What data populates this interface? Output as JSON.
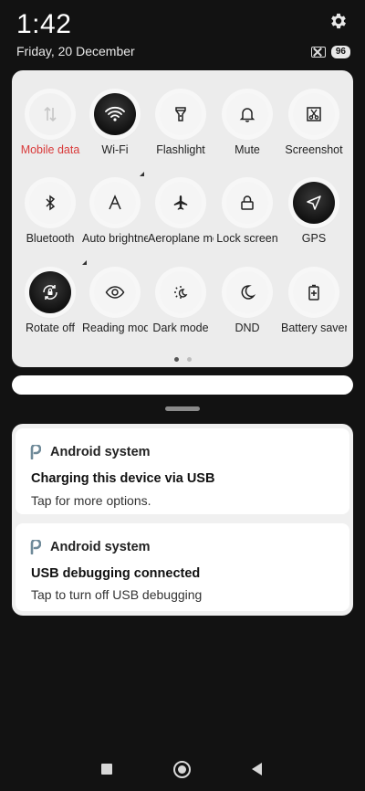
{
  "status_bar": {
    "time": "1:42",
    "date": "Friday, 20 December",
    "battery": "96"
  },
  "tiles": [
    {
      "label": "Mobile data",
      "state": "disabled",
      "icon": "mobile-data-icon",
      "label_color": "#d93a3a"
    },
    {
      "label": "Wi-Fi",
      "state": "on",
      "icon": "wifi-icon",
      "expandable": true
    },
    {
      "label": "Flashlight",
      "state": "off",
      "icon": "flashlight-icon"
    },
    {
      "label": "Mute",
      "state": "off",
      "icon": "bell-icon"
    },
    {
      "label": "Screenshot",
      "state": "off",
      "icon": "screenshot-icon"
    },
    {
      "label": "Bluetooth",
      "state": "off",
      "icon": "bluetooth-icon",
      "expandable": true
    },
    {
      "label": "Auto brightness",
      "state": "off",
      "icon": "auto-brightness-icon"
    },
    {
      "label": "Aeroplane mode",
      "state": "off",
      "icon": "aeroplane-icon"
    },
    {
      "label": "Lock screen",
      "state": "off",
      "icon": "lock-icon"
    },
    {
      "label": "GPS",
      "state": "on",
      "icon": "location-arrow-icon"
    },
    {
      "label": "Rotate off",
      "state": "on",
      "icon": "rotate-lock-icon"
    },
    {
      "label": "Reading mode",
      "state": "off",
      "icon": "eye-icon"
    },
    {
      "label": "Dark mode",
      "state": "off",
      "icon": "dark-mode-icon"
    },
    {
      "label": "DND",
      "state": "off",
      "icon": "moon-icon"
    },
    {
      "label": "Battery saver",
      "state": "off",
      "icon": "battery-saver-icon"
    }
  ],
  "pager": {
    "pages": 2,
    "current": 1
  },
  "notifications": [
    {
      "app": "Android system",
      "title": "Charging this device via USB",
      "text": "Tap for more options."
    },
    {
      "app": "Android system",
      "title": "USB debugging connected",
      "text": "Tap to turn off USB debugging"
    }
  ],
  "colors": {
    "accent_red": "#d93a3a",
    "panel_bg": "#ececec",
    "screen_bg": "#121212"
  }
}
